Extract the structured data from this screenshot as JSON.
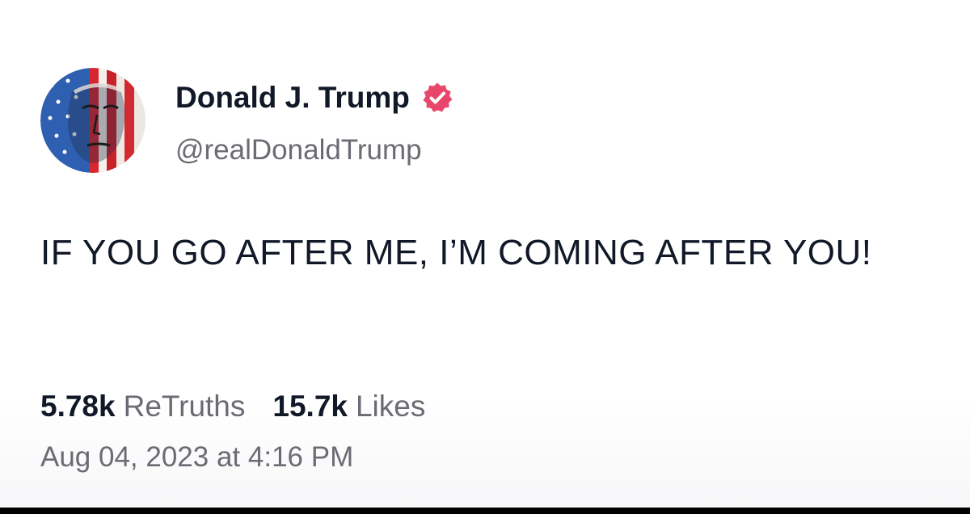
{
  "author": {
    "display_name": "Donald J. Trump",
    "handle": "@realDonaldTrump",
    "verified_icon": "verified-badge-icon",
    "verified_color": "#e8476b",
    "avatar_icon": "profile-avatar"
  },
  "post": {
    "text": "IF YOU GO AFTER ME, I’M COMING AFTER YOU!"
  },
  "stats": {
    "retruths_count": "5.78k",
    "retruths_label": "ReTruths",
    "likes_count": "15.7k",
    "likes_label": "Likes"
  },
  "timestamp": "Aug 04, 2023 at 4:16 PM"
}
